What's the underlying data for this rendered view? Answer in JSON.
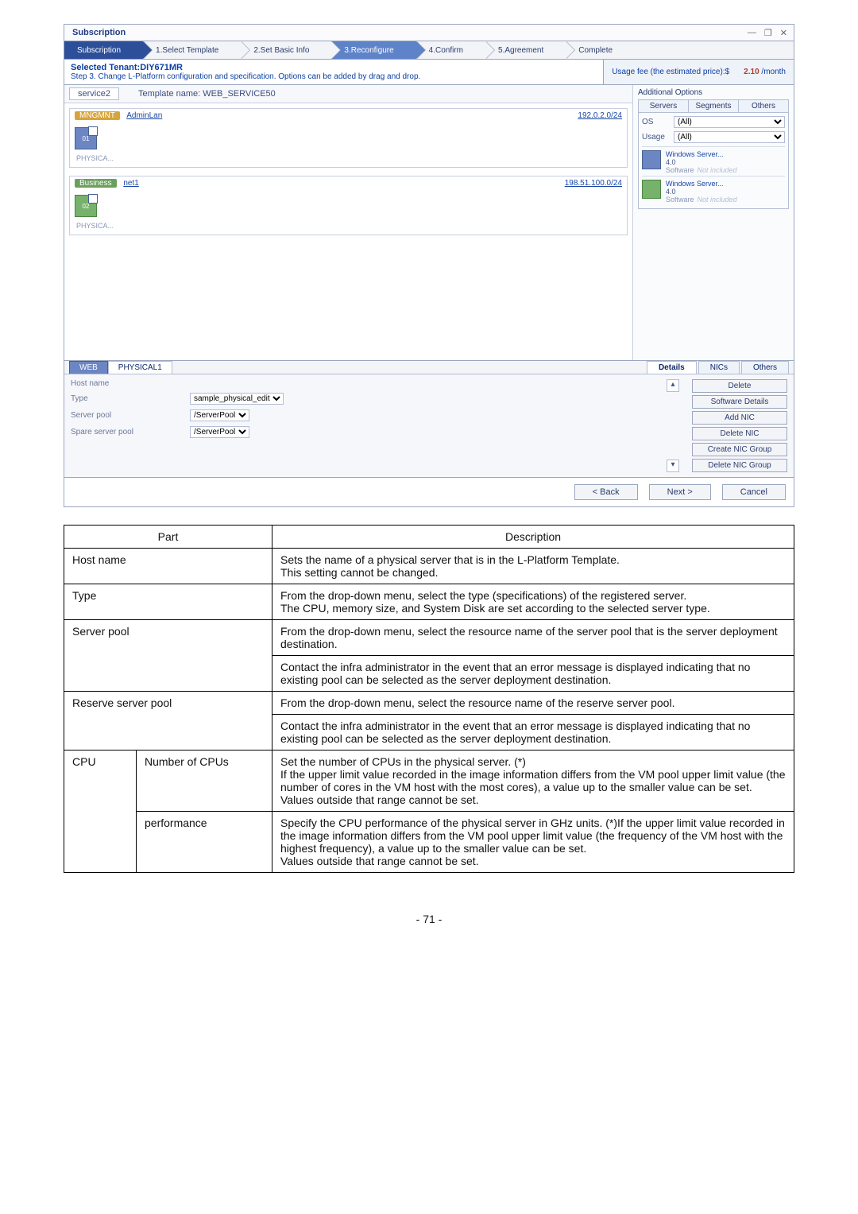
{
  "shot": {
    "winTitle": "Subscription",
    "winButtons": {
      "min": "—",
      "restore": "❐",
      "close": "✕"
    },
    "steps": [
      "Subscription",
      "1.Select Template",
      "2.Set Basic Info",
      "3.Reconfigure",
      "4.Confirm",
      "5.Agreement",
      "Complete"
    ],
    "tenantLabel": "Selected Tenant:DIY671MR",
    "instruction": "Step 3. Change L-Platform configuration and specification. Options can be added by drag and drop.",
    "fee": {
      "label": "Usage fee (the estimated price):$",
      "price": "2.10",
      "unit": "/month"
    },
    "serviceName": "service2",
    "templateLabel": "Template name: WEB_SERVICE50",
    "segments": [
      {
        "tag": "MNGMNT",
        "tagClass": "mgmt",
        "name": "AdminLan",
        "cidr": "192.0.2.0/24",
        "vmId": "01",
        "vmClass": "",
        "phys": "PHYSICA..."
      },
      {
        "tag": "Business",
        "tagClass": "biz",
        "name": "net1",
        "cidr": "198.51.100.0/24",
        "vmId": "02",
        "vmClass": "green",
        "phys": "PHYSICA..."
      }
    ],
    "side": {
      "title": "Additional Options",
      "tabs": [
        "Servers",
        "Segments",
        "Others"
      ],
      "osLabel": "OS",
      "osValue": "(All)",
      "usageLabel": "Usage",
      "usageValue": "(All)",
      "servers": [
        {
          "os": "Windows Server...",
          "mem": "4.0",
          "sw": "Software",
          "swNote": "Not included",
          "ico": ""
        },
        {
          "os": "Windows Server...",
          "mem": "4.0",
          "sw": "Software",
          "swNote": "Not included",
          "ico": "g"
        }
      ]
    },
    "detail": {
      "selLeft": "WEB",
      "selRight": "PHYSICAL1",
      "miniTabs": [
        "Details",
        "NICs",
        "Others"
      ],
      "fields": {
        "hostName": {
          "label": "Host name",
          "value": ""
        },
        "type": {
          "label": "Type",
          "value": "sample_physical_edit"
        },
        "serverPool": {
          "label": "Server pool",
          "value": "/ServerPool"
        },
        "sparePool": {
          "label": "Spare server pool",
          "value": "/ServerPool"
        }
      },
      "actions": [
        "Delete",
        "Software Details",
        "Add NIC",
        "Delete NIC",
        "Create NIC Group",
        "Delete NIC Group"
      ]
    },
    "footer": {
      "back": "< Back",
      "next": "Next >",
      "cancel": "Cancel"
    }
  },
  "table": {
    "headers": [
      "Part",
      "Description"
    ],
    "rows": {
      "hostName": {
        "part": "Host name",
        "desc": "Sets the name of a physical server that is in the L-Platform Template.\nThis setting cannot be changed."
      },
      "type": {
        "part": "Type",
        "desc": "From the drop-down menu, select the type (specifications) of the registered server.\nThe CPU, memory size, and System Disk are set according to the selected server type."
      },
      "serverPool": {
        "part": "Server pool",
        "desc1": "From the drop-down menu, select the resource name of the server pool that is the server deployment destination.",
        "desc2": "Contact the infra administrator in the event that an error message is displayed indicating that no existing pool can be selected as the server deployment destination."
      },
      "reservePool": {
        "part": "Reserve server pool",
        "desc1": "From the drop-down menu, select the resource name of the reserve server pool.",
        "desc2": "Contact the infra administrator in the event that an error message is displayed indicating that no existing pool can be selected as the server deployment destination."
      },
      "cpu": {
        "group": "CPU",
        "num": {
          "part": "Number of CPUs",
          "desc": "Set the number of CPUs in the physical server. (*)\nIf the upper limit value recorded in the image information differs from the VM pool upper limit value (the number of cores in the VM host with the most cores), a value up to the smaller value can be set.\nValues outside that range cannot be set."
        },
        "perf": {
          "part": "performance",
          "desc": "Specify the CPU performance of the physical server in GHz units. (*)If the upper limit value recorded in the image information differs from the VM pool upper limit value (the frequency of the VM host with the highest frequency), a value up to the smaller value can be set.\nValues outside that range cannot be set."
        }
      }
    }
  },
  "pageNumber": "- 71 -"
}
